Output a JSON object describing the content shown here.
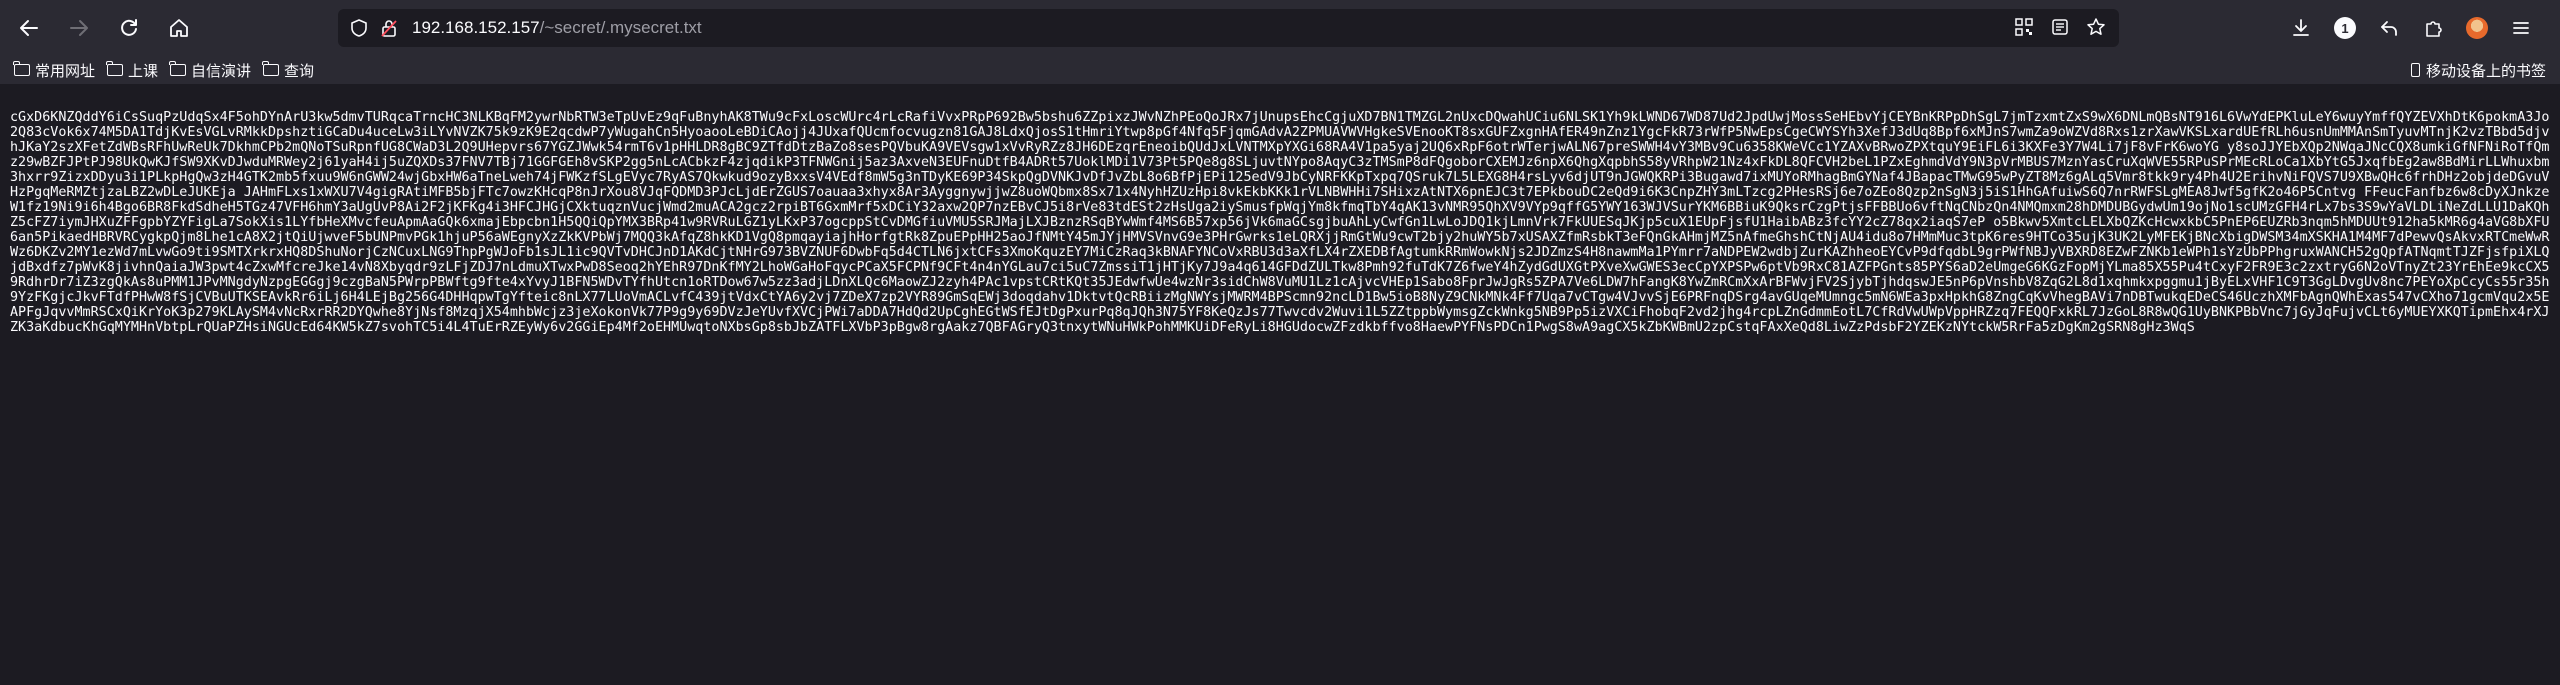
{
  "toolbar": {
    "url_host": "192.168.152.157",
    "url_path": "/~secret/.mysecret.txt",
    "notification_count": "1"
  },
  "bookmarks": {
    "items": [
      {
        "label": "常用网址"
      },
      {
        "label": "上课"
      },
      {
        "label": "自信演讲"
      },
      {
        "label": "查询"
      }
    ],
    "mobile_label": "移动设备上的书签"
  },
  "file_content": "cGxD6KNZQddY6iCsSuqPzUdqSx4F5ohDYnArU3kw5dmvTURqcaTrncHC3NLKBqFM2ywrNbRTW3eTpUvEz9qFuBnyhAK8TWu9cFxLoscWUrc4rLcRafiVvxPRpP692Bw5bshu6ZZpixzJWvNZhPEoQoJRx7jUnupsEhcCgjuXD7BN1TMZGL2nUxcDQwahUCiu6NLSK1Yh9kLWND67WD87Ud2JpdUwjMossSeHEbvYjCEYBnKRPpDhSgL7jmTzxmtZxS9wX6DNLmQBsNT916L6VwYdEPKluLeY6wuyYmffQYZEVXhDtK6pokmA3Jo2Q83cVok6x74M5DA1TdjKvEsVGLvRMkkDpshztiGCaDu4uceLw3iLYvNVZK75k9zK9E2qcdwP7yWugahCn5HyoaooLeBDiCAojj4JUxafQUcmfocvugzn81GAJ8LdxQjosS1tHmriYtwp8pGf4Nfq5FjqmGAdvA2ZPMUAVWVHgkeSVEnooKT8sxGUFZxgnHAfER49nZnz1YgcFkR73rWfP5NwEpsCgeCWYSYh3XefJ3dUq8Bpf6xMJnS7wmZa9oWZVd8Rxs1zrXawVKSLxardUEfRLh6usnUmMMAnSmTyuvMTnjK2vzTBbd5djvhJKaY2szXFetZdWBsRFhUwReUk7DkhmCPb2mQNoTSuRpnfUG8CWaD3L2Q9UHepvrs67YGZJWwk54rmT6v1pHHLDR8gBC9ZTfdDtzBaZo8sesPQVbuKA9VEVsgw1xVvRyRZz8JH6DEzqrEneoibQUdJxLVNTMXpYXGi68RA4V1pa5yaj2UQ6xRpF6otrWTerjwALN67preSWWH4vY3MBv9Cu6358KWeVCc1YZAXvBRwoZPXtquY9EiFL6i3KXFe3Y7W4Li7jF8vFrK6woYG y8soJJYEbXQp2NWqaJNcCQX8umkiGfNFNiRoTfQmz29wBZFJPtPJ98UkQwKJfSW9XKvDJwduMRWey2j61yaH4ij5uZQXDs37FNV7TBj71GGFGEh8vSKP2gg5nLcACbkzF4zjqdikP3TFNWGnij5az3AxveN3EUFnuDtfB4ADRt57UoklMDi1V73Pt5PQe8g8SLjuvtNYpo8AqyC3zTMSmP8dFQgoborCXEMJz6npX6QhgXqpbhS58yVRhpW21Nz4xFkDL8QFCVH2beL1PZxEghmdVdY9N3pVrMBUS7MznYasCruXqWVE55RPuSPrMEcRLoCa1XbYtG5JxqfbEg2aw8BdMirLLWhuxbm3hxrr9ZizxDDyu3i1PLkpHgQw3zH4GTK2mb5fxuu9W6nGWW24wjGbxHW6aTneLweh74jFWKzfSLgEVyc7RyAS7Qkwkud9ozyBxxsV4VEdf8mW5g3nTDyKE69P34SkpQgDVNKJvDfJvZbL8o6BfPjEPi125edV9JbCyNRFKKpTxpq7QSruk7L5LEXG8H4rsLyv6djUT9nJGWQKRPi3Bugawd7ixMUYoRMhagBmGYNaf4JBapacTMwG95wPyZT8Mz6gALq5Vmr8tkk9ry4Ph4U2ErihvNiFQVS7U9XBwQHc6frhDHz2objdeDGvuVHzPgqMeRMZtjzaLBZ2wDLeJUKEja JAHmFLxs1xWXU7V4gigRAtiMFB5bjFTc7owzKHcqP8nJrXou8VJqFQDMD3PJcLjdErZGUS7oauaa3xhyx8Ar3AyggnywjjwZ8uoWQbmx8Sx71x4NyhHZUzHpi8vkEkbKKk1rVLNBWHHi7SHixzAtNTX6pnEJC3t7EPkbouDC2eQd9i6K3CnpZHY3mLTzcg2PHesRSj6e7oZEo8Qzp2nSgN3j5iS1HhGAfuiwS6Q7nrRWFSLgMEA8Jwf5gfK2o46P5Cntvg FFeucFanfbz6w8cDyXJnkzeW1fz19Ni9i6h4Bgo6BR8FkdSdheH5TGz47VFH6hmY3aUgUvP8Ai2F2jKFKg4i3HFCJHGjCXktuqznVucjWmd2muACA2gcz2rpiBT6GxmMrf5xDCiY32axw2QP7nzEBvCJ5i8rVe83tdESt2zHsUga2iySmusfpWqjYm8kfmqTbY4qAK13vNMR95QhXV9VYp9qffG5YWY163WJVSurYKM6BBiuK9QksrCzgPtjsFFBBUo6vftNqCNbzQn4NMQmxm28hDMDUBGydwUm19ojNo1scUMzGFH4rLx7bs3S9wYaVLDLiNeZdLLU1DaKQhZ5cFZ7iymJHXuZFFgpbYZYFigLa7SokXis1LYfbHeXMvcfeuApmAaGQk6xmajEbpcbn1H5QQiQpYMX3BRp41w9RVRuLGZ1yLKxP37ogcppStCvDMGfiuVMU5SRJMajLXJBznzRSqBYwWmf4MS6B57xp56jVk6maGCsgjbuAhLyCwfGn1LwLoJDQ1kjLmnVrk7FkUUESqJKjp5cuX1EUpFjsfU1HaibABz3fcYY2cZ78qx2iaqS7eP o5Bkwv5XmtcLELXbQZKcHcwxkbC5PnEP6EUZRb3nqm5hMDUUt912ha5kMR6g4aVG8bXFU6an5PikaedHBRVRCygkpQjm8Lhe1cA8X2jtQiUjwveF5bUNPmvPGk1hjuP56aWEgnyXzZkKVPbWj7MQQ3kAfqZ8hkKD1VgQ8pmqayiajhHorfgtRk8ZpuEPpHH25aoJfNMtY45mJYjHMVSVnvG9e3PHrGwrks1eLQRXjjRmGtWu9cwT2bjy2huWY5b7xUSAXZfmRsbkT3eFQnGkAHmjMZ5nAfmeGhshCtNjAU4idu8o7HMmMuc3tpK6res9HTCo35ujK3UK2LyMFEKjBNcXbigDWSM34mXSKHA1M4MF7dPewvQsAkvxRTCmeWwRWz6DKZv2MY1ezWd7mLvwGo9ti9SMTXrkrxHQ8DShuNorjCzNCuxLNG9ThpPgWJoFb1sJL1ic9QVTvDHCJnD1AKdCjtNHrG973BVZNUF6DwbFq5d4CTLN6jxtCFs3XmoKquzEY7MiCzRaq3kBNAFYNCoVxRBU3d3aXfLX4rZXEDBfAgtumkRRmWowkNjs2JDZmzS4H8nawmMa1PYmrr7aNDPEW2wdbjZurKAZhheoEYCvP9dfqdbL9grPWfNBJyVBXRD8EZwFZNKb1eWPh1sYzUbPPhgruxWANCH52gQpfATNqmtTJZFjsfpiXLQjdBxdfz7pWvK8jivhnQaiaJW3pwt4cZxwMfcreJke14vN8Xbyqdr9zLFjZDJ7nLdmuXTwxPwD8Seoq2hYEhR97DnKfMY2LhoWGaHoFqycPCaX5FCPNf9CFt4n4nYGLau7ci5uC7ZmssiT1jHTjKy7J9a4q614GFDdZULTkw8Pmh92fuTdK7Z6fweY4hZydGdUXGtPXveXwGWES3ecCpYXPSPw6ptVb9RxC81AZFPGnts85PYS6aD2eUmgeG6KGzFopMjYLma85X55Pu4tCxyF2FR9E3c2zxtryG6N2oVTnyZt23YrEhEe9kcCX59RdhrDr7iZ3zgQkAs8uPMM1JPvMNgdyNzpgEGGgj9czgBaN5PWrpPBWftg9fte4xYvyJ1BFN5WDvTYfhUtcn1oRTDow67w5zz3adjLDnXLQc6MaowZJ2zyh4PAc1vpstCRtKQt35JEdwfwUe4wzNr3sidChW8VuMU1Lz1cAjvcVHEp1Sabo8FprJwJgRs5ZPA7Ve6LDW7hFangK8YwZmRCmXxArBFWvjFV2SjybTjhdqswJE5nP6pVnshbV8ZqG2L8d1xqhmkxpggmu1jByELxVHF1C9T3GgLDvgUv8nc7PEYoXpCcyCs55r35h9YzFKgjcJkvFTdfPHwW8fSjCVBuUTKSEAvkRr6iLj6H4LEjBg256G4DHHqpwTgYfteic8nLX77LUoVmACLvfC439jtVdxCtYA6y2vj7ZDeX7zp2VYR89GmSqEWj3doqdahv1DktvtQcRBiizMgNWYsjMWRM4BPScmn92ncLD1Bw5ioB8NyZ9CNkMNk4Ff7Uqa7vCTgw4VJvvSjE6PRFnqDSrg4avGUqeMUmngc5mN6WEa3pxHpkhG8ZngCqKvVhegBAVi7nDBTwukqEDeCS46UczhXMFbAgnQWhExas547vCXho71gcmVqu2x5EAPFgJqvvMmRSCxQiKrYoK3p279KLAySM4vNcRxrRR2DYQwhe8YjNsf8MzqjX54mhbWcjz3jeXokonVk77P9g9y69DVzJeYUvfXVCjPWi7aDDA7HdQd2UpCghEGtWSfEJtDgPxurPq8qJQh3N75YF8KeQzJs77Twvcdv2Wuvi1L5ZZtppbWymsgZckWnkg5NB9Pp5izVXCiFhobqF2vd2jhg4rcpLZnGdmmEotL7CfRdVwUWpVppHRZzq7FEQQFxkRL7JzGoL8R8wQG1UyBNKPBbVnc7jGyJqFujvCLt6yMUEYXKQTipmEhx4rXJZK3aKdbucKhGqMYMHnVbtpLrQUaPZHsiNGUcEd64KW5kZ7svohTC5i4L4TuErRZEyWy6v2GGiEp4Mf2oEHMUwqtoNXbsGp8sbJbZATFLXVbP3pBgw8rgAakz7QBFAGryQ3tnxytWNuHWkPohMMKUiDFeRyLi8HGUdocwZFzdkbffvo8HaewPYFNsPDCn1PwgS8wA9agCX5kZbKWBmU2zpCstqFAxXeQd8LiwZzPdsbF2YZEKzNYtckW5RrFa5zDgKm2gSRN8gHz3WqS"
}
